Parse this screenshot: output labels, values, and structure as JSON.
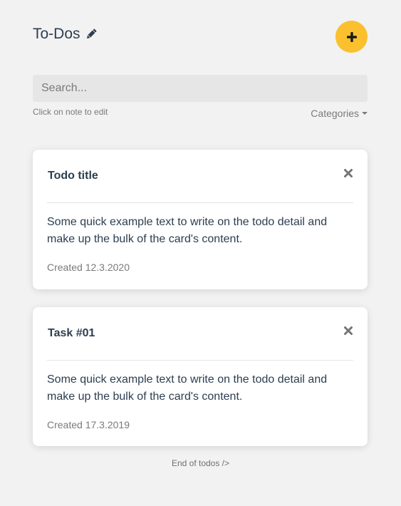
{
  "header": {
    "title": "To-Dos",
    "edit_icon": "pencil-icon",
    "add_icon": "plus-icon",
    "accent_color": "#fbc02d"
  },
  "search": {
    "placeholder": "Search...",
    "value": ""
  },
  "hint": "Click on note to edit",
  "categories": {
    "label": "Categories",
    "icon": "caret-down-icon"
  },
  "todos": [
    {
      "title": "Todo title",
      "text": "Some quick example text to write on the todo detail and make up the bulk of the card's content.",
      "created": "Created 12.3.2020",
      "close_icon": "close-icon"
    },
    {
      "title": "Task #01",
      "text": "Some quick example text to write on the todo detail and make up the bulk of the card's content.",
      "created": "Created 17.3.2019",
      "close_icon": "close-icon"
    }
  ],
  "footer": "End of todos />"
}
